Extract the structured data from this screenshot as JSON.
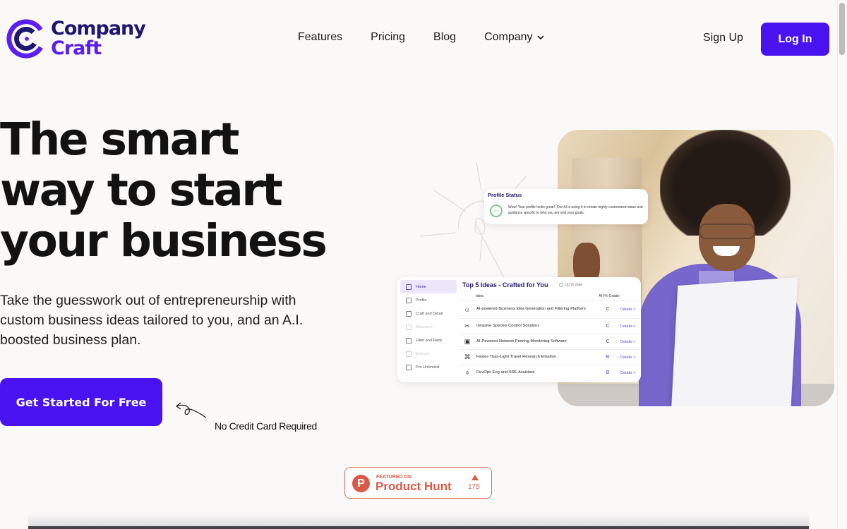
{
  "header": {
    "logo": {
      "line1": "Company",
      "line2": "Craft"
    },
    "nav": [
      {
        "label": "Features"
      },
      {
        "label": "Pricing"
      },
      {
        "label": "Blog"
      },
      {
        "label": "Company",
        "has_dropdown": true
      }
    ],
    "signup_label": "Sign Up",
    "login_label": "Log In"
  },
  "hero": {
    "headline": [
      "The smart",
      "way to start",
      "your business"
    ],
    "subtitle": "Take the guesswork out of entrepreneurship with custom business ideas tailored to you, and an A.I. boosted business plan.",
    "cta_label": "Get Started For Free",
    "cta_note": "No Credit Card Required"
  },
  "profile_status": {
    "title": "Profile Status",
    "progress_label": "85%",
    "message": "Wow! Your profile looks great!. Our AI is using it to create highly-customized ideas and guidance specific to who you are and your goals."
  },
  "ideas_panel": {
    "sidebar": [
      {
        "label": "Home",
        "icon": "home-icon",
        "state": "active"
      },
      {
        "label": "Profile",
        "icon": "profile-icon",
        "state": "normal"
      },
      {
        "label": "Craft and Detail",
        "icon": "pencil-icon",
        "state": "normal"
      },
      {
        "label": "Research",
        "icon": "research-icon",
        "state": "disabled"
      },
      {
        "label": "Filter and Rank",
        "icon": "filter-icon",
        "state": "normal"
      },
      {
        "label": "Execute",
        "icon": "execute-icon",
        "state": "disabled"
      },
      {
        "label": "Pro Unlimited",
        "icon": "dollar-icon",
        "state": "normal"
      }
    ],
    "title": "Top 5 Ideas - Crafted for You",
    "status": "Up to date",
    "columns": {
      "idea": "Idea",
      "grade": "AI Fit Grade"
    },
    "rows": [
      {
        "icon": "robot-icon",
        "glyph": "☺",
        "name": "AI-powered Business Idea Generation and Filtering Platform",
        "grade": "C",
        "link": "Details >"
      },
      {
        "icon": "bug-spray-icon",
        "glyph": "✂",
        "name": "Invasive Species Control Solutions",
        "grade": "C",
        "link": "Details >"
      },
      {
        "icon": "monitor-chart-icon",
        "glyph": "▣",
        "name": "AI-Powered Network Peering Monitoring Software",
        "grade": "C",
        "link": "Details >"
      },
      {
        "icon": "rocket-icon",
        "glyph": "⌘",
        "name": "Faster-Than-Light Travel Research Initiative",
        "grade": "B",
        "link": "Details >"
      },
      {
        "icon": "devops-icon",
        "glyph": "⌽",
        "name": "DevOps Eng and SRE Assistant",
        "grade": "B",
        "link": "Details >"
      }
    ]
  },
  "product_hunt": {
    "featured": "FEATURED ON",
    "name": "Product Hunt",
    "logo_letter": "P",
    "upvotes": "175"
  },
  "colors": {
    "brand": "#4913f1",
    "brand_dark": "#1e1670",
    "product_hunt": "#da5a4a",
    "background": "#fbf9f8"
  }
}
